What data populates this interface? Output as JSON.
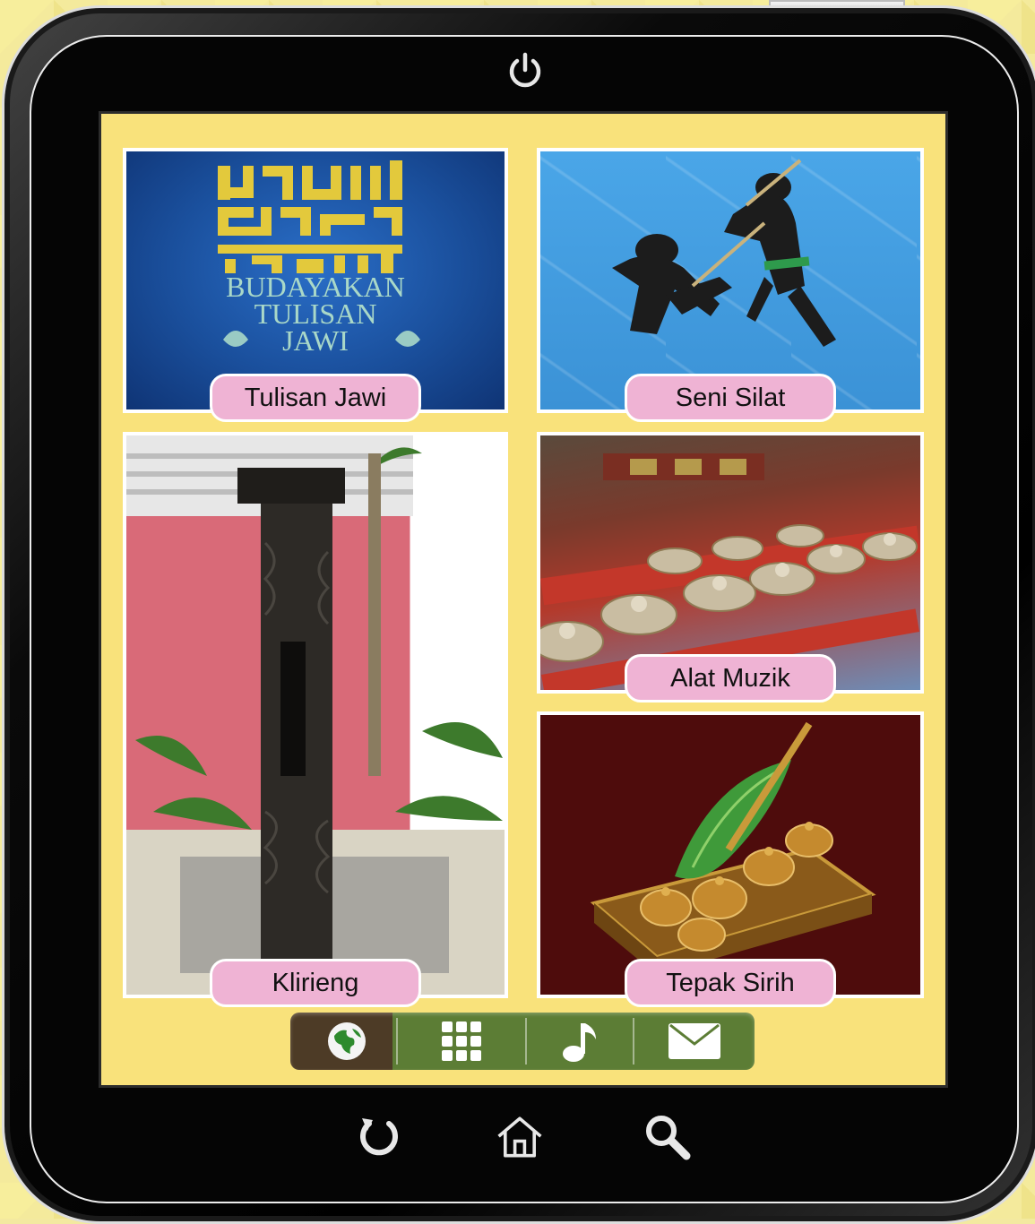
{
  "screen": {
    "tiles": [
      {
        "caption": "Tulisan Jawi",
        "image": "jawi-calligraphy-image"
      },
      {
        "caption": "Seni Silat",
        "image": "silat-martial-arts-image"
      },
      {
        "caption": "Klirieng",
        "image": "klirieng-totem-image"
      },
      {
        "caption": "Alat Muzik",
        "image": "gamelan-instruments-image"
      },
      {
        "caption": "Tepak Sirih",
        "image": "tepak-sirih-image"
      }
    ],
    "jawi_text": [
      "BUDAYAKAN",
      "TULISAN",
      "JAWI"
    ]
  },
  "dock": {
    "items": [
      "globe-icon",
      "apps-grid-icon",
      "music-note-icon",
      "mail-icon"
    ]
  },
  "hardware": {
    "top": "power-icon",
    "bottom": [
      "back-icon",
      "home-icon",
      "search-icon"
    ]
  },
  "colors": {
    "screen_bg": "#f9e27b",
    "caption_bg": "#efb3d4",
    "dock_green": "#5c7d35",
    "dock_brown": "#4d3b26"
  }
}
